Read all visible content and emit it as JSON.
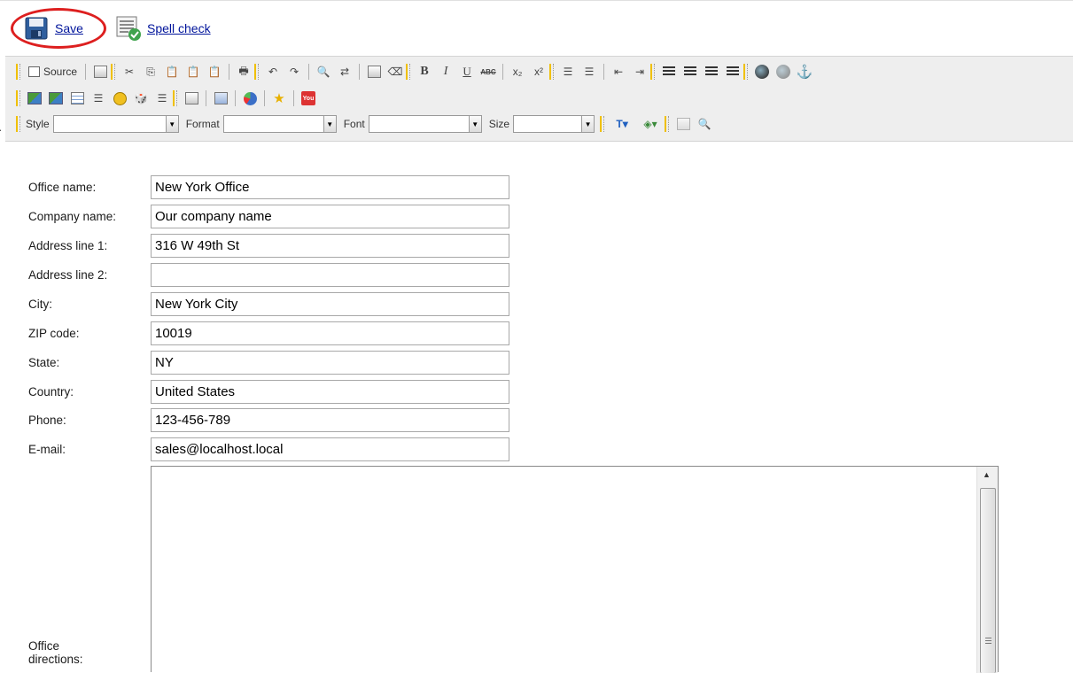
{
  "actions": {
    "save_label": "Save",
    "spell_label": "Spell check",
    "highlight_color": "#dd1f1f"
  },
  "toolbar": {
    "row1": [
      "source",
      "preview",
      "cut",
      "copy",
      "paste",
      "paste-text",
      "paste-word",
      "print",
      "undo",
      "redo",
      "find",
      "replace",
      "select-all",
      "remove-format",
      "bold",
      "italic",
      "underline",
      "strikethrough",
      "subscript",
      "superscript",
      "numbered-list",
      "bulleted-list",
      "outdent",
      "indent",
      "align-left",
      "align-center",
      "align-right",
      "justify",
      "link",
      "unlink",
      "anchor"
    ],
    "source_label": "Source",
    "row2": [
      "image",
      "insert-image",
      "table",
      "horizontal-rule",
      "smiley",
      "special-char",
      "page-break",
      "template",
      "form",
      "media",
      "favorite",
      "youtube"
    ],
    "youtube_text": "You",
    "combos": {
      "style_label": "Style",
      "format_label": "Format",
      "font_label": "Font",
      "size_label": "Size"
    }
  },
  "form": {
    "fields": [
      {
        "label": "Office name:",
        "value": "New York Office"
      },
      {
        "label": "Company name:",
        "value": "Our company name"
      },
      {
        "label": "Address line 1:",
        "value": "316 W 49th St"
      },
      {
        "label": "Address line 2:",
        "value": ""
      },
      {
        "label": "City:",
        "value": "New York City"
      },
      {
        "label": "ZIP code:",
        "value": "10019"
      },
      {
        "label": "State:",
        "value": "NY"
      },
      {
        "label": "Country:",
        "value": "United States"
      },
      {
        "label": "Phone:",
        "value": "123-456-789"
      },
      {
        "label": "E-mail:",
        "value": "sales@localhost.local"
      }
    ],
    "directions_label": "Office directions:",
    "directions_value": ""
  }
}
